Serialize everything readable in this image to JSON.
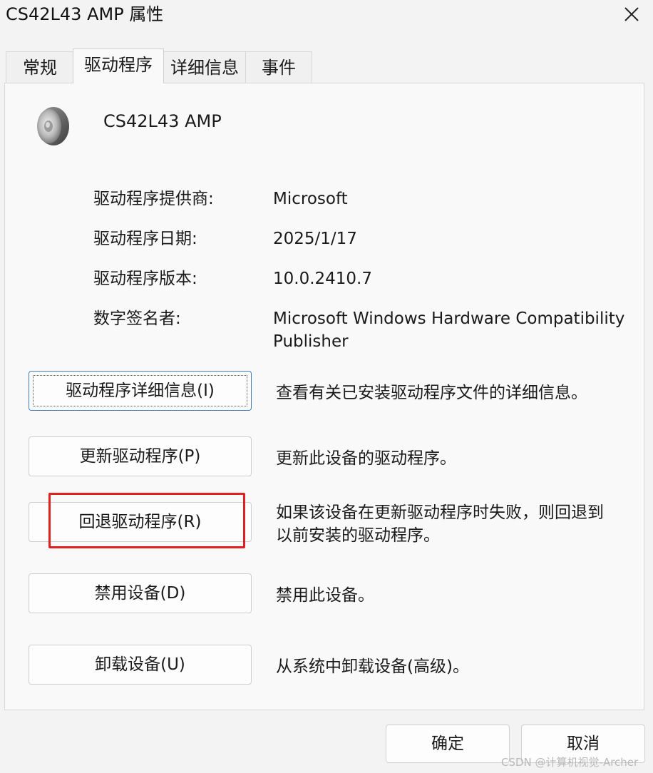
{
  "window": {
    "title": "CS42L43 AMP 属性"
  },
  "tabs": [
    {
      "label": "常规"
    },
    {
      "label": "驱动程序",
      "active": true
    },
    {
      "label": "详细信息"
    },
    {
      "label": "事件"
    }
  ],
  "device": {
    "name": "CS42L43 AMP",
    "icon": "speaker-icon"
  },
  "driver_info": {
    "provider_label": "驱动程序提供商:",
    "provider_value": "Microsoft",
    "date_label": "驱动程序日期:",
    "date_value": "2025/1/17",
    "version_label": "驱动程序版本:",
    "version_value": "10.0.2410.7",
    "signer_label": "数字签名者:",
    "signer_value_line1": "Microsoft Windows Hardware Compatibility",
    "signer_value_line2": "Publisher"
  },
  "actions": {
    "details_button": "驱动程序详细信息(I)",
    "details_desc": "查看有关已安装驱动程序文件的详细信息。",
    "update_button": "更新驱动程序(P)",
    "update_desc": "更新此设备的驱动程序。",
    "rollback_button": "回退驱动程序(R)",
    "rollback_desc_line1": "如果该设备在更新驱动程序时失败，则回退到",
    "rollback_desc_line2": "以前安装的驱动程序。",
    "disable_button": "禁用设备(D)",
    "disable_desc": "禁用此设备。",
    "uninstall_button": "卸载设备(U)",
    "uninstall_desc": "从系统中卸载设备(高级)。"
  },
  "footer": {
    "ok_label": "确定",
    "cancel_label": "取消"
  },
  "watermark": "CSDN @计算机视觉-Archer",
  "colors": {
    "highlight": "#e02020",
    "focus_border": "#3e7cc0"
  }
}
